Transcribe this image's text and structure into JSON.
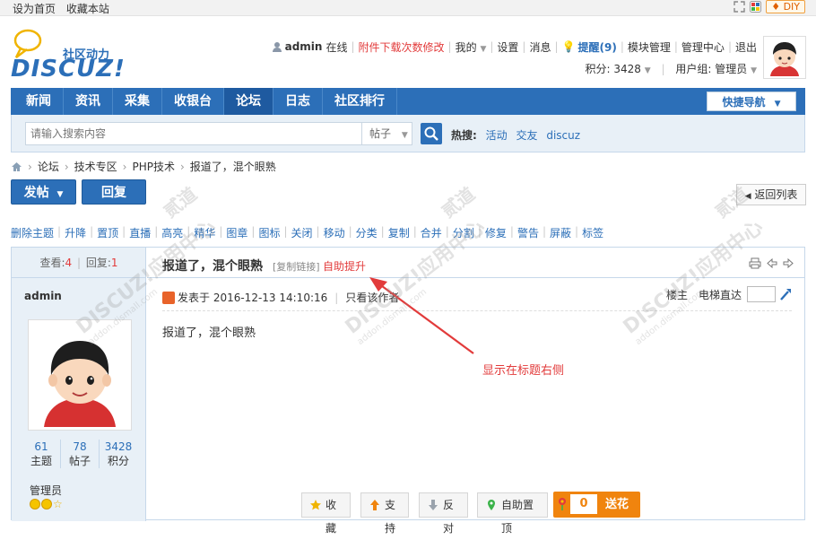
{
  "topbar": {
    "links": [
      "设为首页",
      "收藏本站"
    ],
    "diy_label": "DIY"
  },
  "logo": {
    "tagline": "社区动力",
    "brand": "DISCUZ!"
  },
  "user": {
    "name": "admin",
    "online": "在线",
    "attachment_link": "附件下载次数修改",
    "mine": "我的",
    "settings": "设置",
    "messages": "消息",
    "reminders": "提醒(9)",
    "block_admin": "模块管理",
    "admin_center": "管理中心",
    "logout": "退出",
    "credits": "积分: 3428",
    "usergroup": "用户组: 管理员"
  },
  "nav": {
    "items": [
      "新闻",
      "资讯",
      "采集",
      "收银台",
      "论坛",
      "日志",
      "社区排行"
    ],
    "active_index": 4,
    "quick_nav": "快捷导航"
  },
  "search": {
    "placeholder": "请输入搜索内容",
    "type": "帖子",
    "hot_label": "热搜:",
    "hot_words": [
      "活动",
      "交友",
      "discuz"
    ]
  },
  "breadcrumb": [
    "论坛",
    "技术专区",
    "PHP技术",
    "报道了，混个眼熟"
  ],
  "actions": {
    "post": "发帖",
    "reply": "回复",
    "back": "返回列表"
  },
  "moderation": [
    "删除主题",
    "升降",
    "置顶",
    "直播",
    "高亮",
    "精华",
    "图章",
    "图标",
    "关闭",
    "移动",
    "分类",
    "复制",
    "合并",
    "分割",
    "修复",
    "警告",
    "屏蔽",
    "标签"
  ],
  "thread": {
    "views_label": "查看:",
    "views": "4",
    "replies_label": "回复:",
    "replies": "1",
    "title": "报道了，混个眼熟",
    "copy_link": "[复制链接]",
    "boost": "自助提升",
    "content": "报道了，混个眼熟"
  },
  "post": {
    "author": "admin",
    "posted_at": "发表于 2016-12-13 14:10:16",
    "author_only": "只看该作者",
    "floor": "楼主",
    "jump_label": "电梯直达"
  },
  "profile": {
    "stats": [
      {
        "value": "61",
        "label": "主题"
      },
      {
        "value": "78",
        "label": "帖子"
      },
      {
        "value": "3428",
        "label": "积分"
      }
    ],
    "group": "管理员"
  },
  "annotation": "显示在标题右侧",
  "post_actions": {
    "favorite": "收藏",
    "support": "支持",
    "oppose": "反对",
    "self_stick": "自助置顶",
    "flower_count": "0",
    "flower": "送花"
  },
  "watermark": {
    "brand": "DISCUZ!应用中心",
    "url": "addon.dismall.com",
    "word": "贰道"
  },
  "colors": {
    "accent": "#2c6fb8",
    "highlight": "#e23b3b",
    "flower": "#f0840e"
  }
}
